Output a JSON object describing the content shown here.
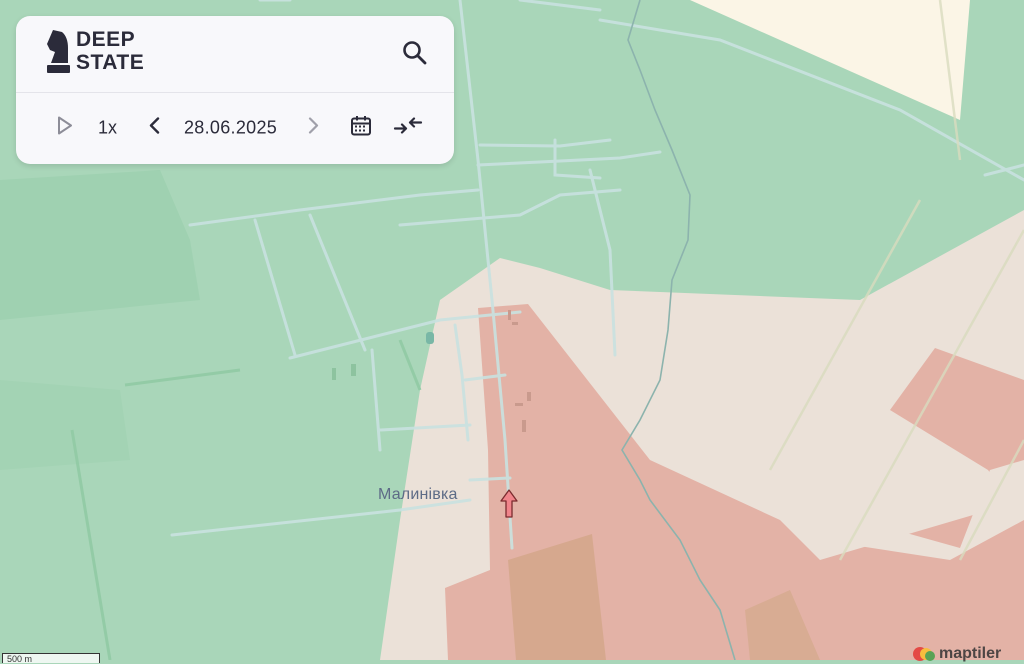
{
  "app": {
    "logo_line1": "DEEP",
    "logo_line2": "STATE"
  },
  "toolbar": {
    "speed": "1x",
    "date": "28.06.2025"
  },
  "map": {
    "settlement_label": "Малинівка",
    "scale_label": "500 m",
    "attribution": "maptiler",
    "colors": {
      "liberated_green": "#a9d6b9",
      "contested_beige": "#ebe1d8",
      "occupied_red": "#e3b2a6",
      "occupied_dark": "#d6a88e",
      "cream_area": "#fbf5e6",
      "road": "#c9dfe0",
      "river": "#8cb3ad",
      "advance_arrow": "#f0848a"
    }
  },
  "icons": {
    "logo": "chess-knight-icon",
    "search": "search-icon",
    "play": "play-icon",
    "prev": "chevron-left-icon",
    "next": "chevron-right-icon",
    "calendar": "calendar-icon",
    "compress": "compress-arrows-icon",
    "arrow": "arrow-up-icon"
  }
}
